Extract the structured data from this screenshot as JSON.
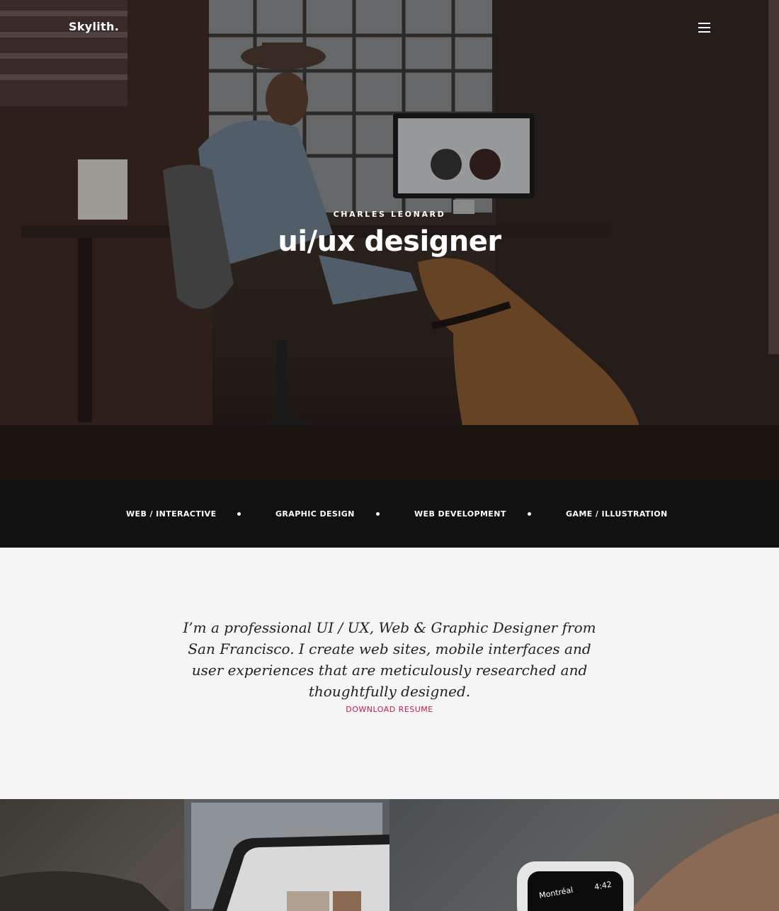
{
  "header": {
    "logo": "Skylith.",
    "menu_icon": "hamburger-menu-icon"
  },
  "hero": {
    "subtitle": "CHARLES LEONARD",
    "title": "ui/ux designer"
  },
  "services": [
    {
      "label": "WEB / INTERACTIVE"
    },
    {
      "label": "GRAPHIC DESIGN"
    },
    {
      "label": "WEB DEVELOPMENT"
    },
    {
      "label": "GAME / ILLUSTRATION"
    }
  ],
  "intro": {
    "text": "I’m a professional UI / UX, Web & Graphic Designer from San Francisco. I create web sites, mobile interfaces and user experiences that are meticulously researched and thoughtfully designed.",
    "resume_link": "DOWNLOAD RESUME"
  },
  "gallery": {
    "watch_city": "Montréal",
    "watch_time": "4:42"
  },
  "colors": {
    "accent": "#c41e4a",
    "services_bg": "#111111",
    "intro_bg": "#f5f5f5"
  }
}
